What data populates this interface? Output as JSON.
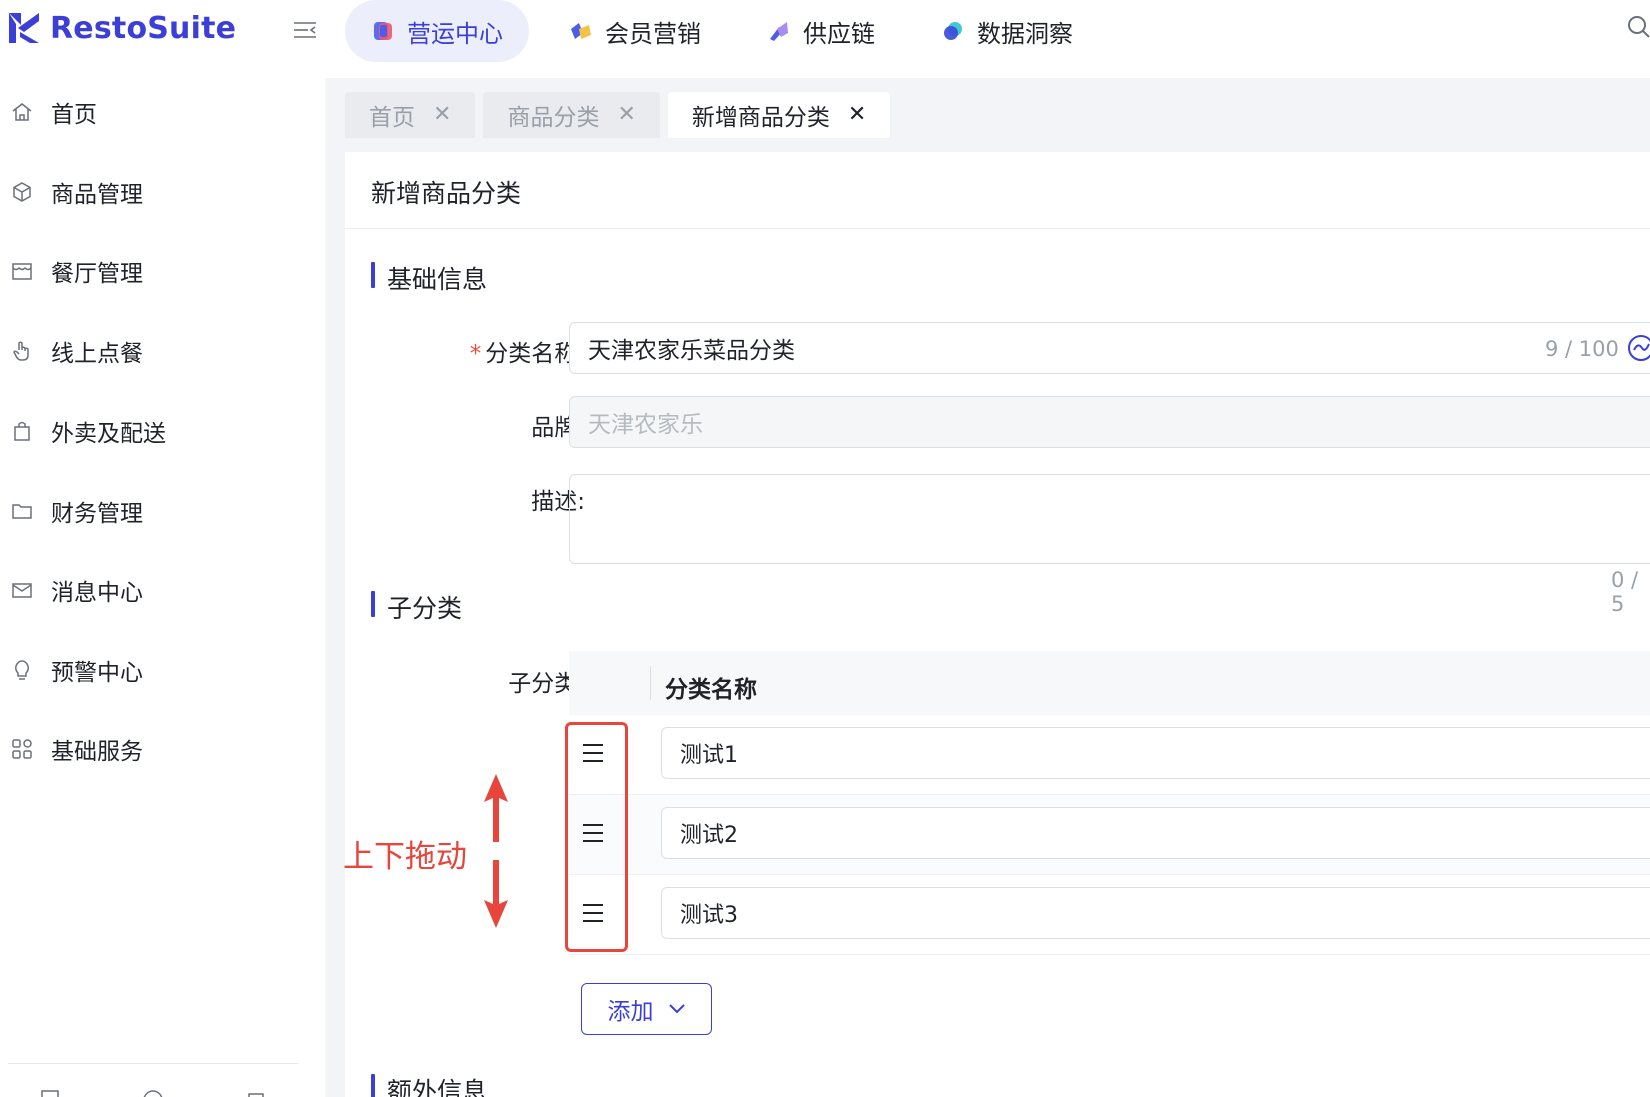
{
  "app": {
    "name": "RestoSuite",
    "brand_color": "#3b3fd8"
  },
  "topnav": [
    {
      "label": "营运中心",
      "icon": "operations-icon",
      "active": true
    },
    {
      "label": "会员营销",
      "icon": "membership-icon",
      "active": false
    },
    {
      "label": "供应链",
      "icon": "supply-chain-icon",
      "active": false
    },
    {
      "label": "数据洞察",
      "icon": "data-insight-icon",
      "active": false
    }
  ],
  "sidebar": {
    "items": [
      {
        "label": "首页",
        "icon": "home-icon"
      },
      {
        "label": "商品管理",
        "icon": "cube-icon"
      },
      {
        "label": "餐厅管理",
        "icon": "store-icon"
      },
      {
        "label": "线上点餐",
        "icon": "hand-pointer-icon"
      },
      {
        "label": "外卖及配送",
        "icon": "shopping-bag-icon"
      },
      {
        "label": "财务管理",
        "icon": "wallet-icon"
      },
      {
        "label": "消息中心",
        "icon": "mail-icon"
      },
      {
        "label": "预警中心",
        "icon": "bulb-icon"
      },
      {
        "label": "基础服务",
        "icon": "grid-icon"
      }
    ]
  },
  "tabs": [
    {
      "label": "首页",
      "active": false
    },
    {
      "label": "商品分类",
      "active": false
    },
    {
      "label": "新增商品分类",
      "active": true
    }
  ],
  "page": {
    "title": "新增商品分类",
    "basic_section": "基础信息",
    "name_label": "分类名称:",
    "name_value": "天津农家乐菜品分类",
    "name_counter": "9 / 100",
    "brand_label": "品牌:",
    "brand_value": "天津农家乐",
    "desc_label": "描述:",
    "desc_counter": "0 / 5",
    "sub_section": "子分类",
    "sub_label": "子分类:",
    "table_header": "分类名称",
    "sub_items": [
      "测试1",
      "测试2",
      "测试3"
    ],
    "add_button": "添加",
    "extra_section": "额外信息"
  },
  "annotation": {
    "text": "上下拖动",
    "color": "#e8453c"
  }
}
